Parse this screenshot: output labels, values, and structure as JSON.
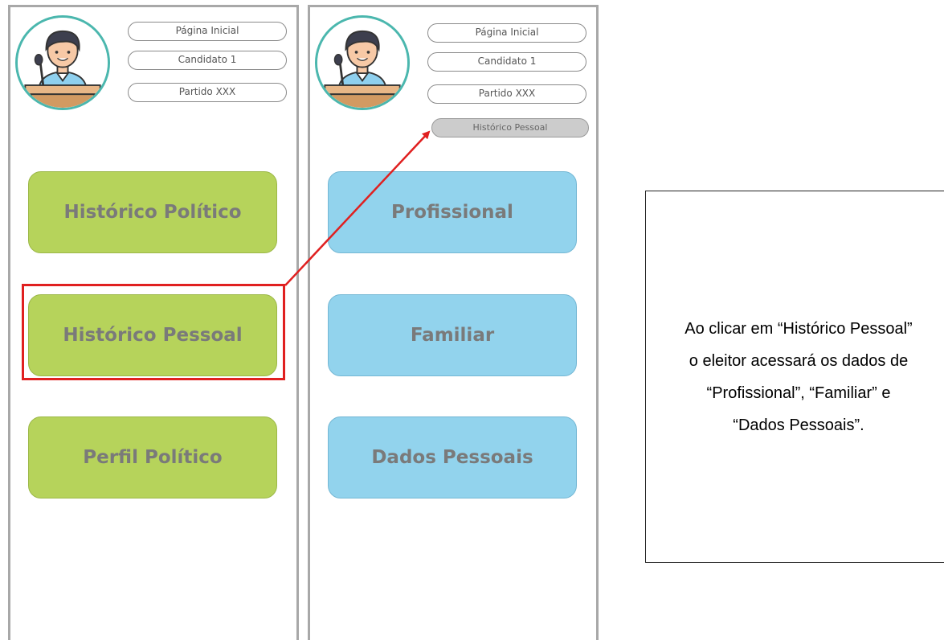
{
  "colors": {
    "green_button": "#b6d35b",
    "blue_button": "#92d3ed",
    "avatar_ring": "#4bb7ae",
    "highlight": "#e02020",
    "arrow": "#e02020"
  },
  "screen1": {
    "nav": {
      "home": "Página Inicial",
      "candidate": "Candidato 1",
      "party": "Partido XXX"
    },
    "buttons": {
      "political_history": "Histórico Político",
      "personal_history": "Histórico Pessoal",
      "political_profile": "Perfil Político"
    }
  },
  "screen2": {
    "nav": {
      "home": "Página Inicial",
      "candidate": "Candidato 1",
      "party": "Partido XXX",
      "current": "Histórico Pessoal"
    },
    "buttons": {
      "professional": "Profissional",
      "family": "Familiar",
      "personal_data": "Dados Pessoais"
    }
  },
  "note": {
    "text": "Ao clicar em “Histórico Pessoal” o eleitor acessará os dados de “Profissional”, “Familiar” e “Dados Pessoais”."
  },
  "icons": {
    "avatar": "candidate-speaker-icon",
    "arrow": "arrow-icon"
  }
}
